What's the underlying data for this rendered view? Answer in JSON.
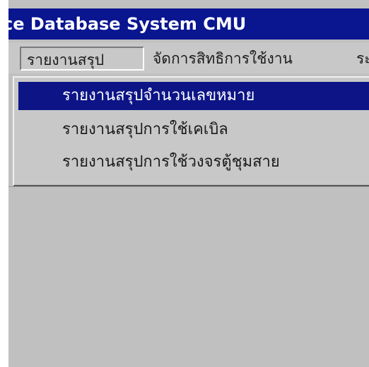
{
  "window": {
    "title": "ce Database System CMU"
  },
  "menubar": {
    "items": [
      {
        "label": "รายงานสรุป"
      },
      {
        "label": "จัดการสิทธิการใช้งาน"
      },
      {
        "label": "ระ"
      }
    ]
  },
  "dropdown": {
    "items": [
      {
        "label": "รายงานสรุปจำนวนเลขหมาย"
      },
      {
        "label": "รายงานสรุปการใช้เคเบิล"
      },
      {
        "label": "รายงานสรุปการใช้วงจรตู้ชุมสาย"
      }
    ]
  },
  "colors": {
    "titlebar": "#0a1590",
    "highlight": "#0c1486",
    "face": "#c0c0c0"
  }
}
